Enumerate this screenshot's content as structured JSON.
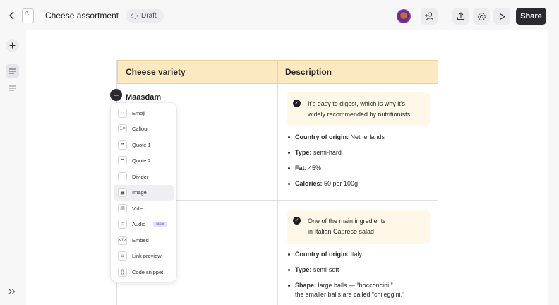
{
  "header": {
    "title": "Cheese assortment",
    "status": "Draft",
    "share_label": "Share"
  },
  "table": {
    "headers": [
      "Cheese variety",
      "Description"
    ],
    "rows": [
      {
        "name": "Maasdam",
        "callout_line1": "It's easy to digest, which is why it's",
        "callout_line2": "widely recommended by nutritionists.",
        "facts": [
          {
            "label": "Country of origin:",
            "value": "Netherlands"
          },
          {
            "label": "Type:",
            "value": "semi-hard"
          },
          {
            "label": "Fat:",
            "value": "45%"
          },
          {
            "label": "Calories:",
            "value": "50 per 100g"
          }
        ]
      },
      {
        "callout_line1": "One of the main ingredients",
        "callout_line2": "in Italian Caprese salad",
        "facts": [
          {
            "label": "Country of origin:",
            "value": "Italy"
          },
          {
            "label": "Type:",
            "value": "semi-soft"
          },
          {
            "label": "Shape:",
            "value": "large balls — “bocconcini,”",
            "value2": "the smaller balls are called “chileggini.”"
          }
        ]
      }
    ]
  },
  "insert_menu": {
    "items": [
      {
        "label": "Emoji",
        "icon": "emoji-icon",
        "glyph": "☺"
      },
      {
        "label": "Callout",
        "icon": "callout-icon",
        "glyph": "1≡"
      },
      {
        "label": "Quote 1",
        "icon": "quote-icon",
        "glyph": "❝"
      },
      {
        "label": "Quote 2",
        "icon": "quote-alt-icon",
        "glyph": "❞"
      },
      {
        "label": "Divider",
        "icon": "divider-icon",
        "glyph": "—"
      },
      {
        "label": "Image",
        "icon": "image-icon",
        "glyph": "▣"
      },
      {
        "label": "Video",
        "icon": "video-icon",
        "glyph": "▤"
      },
      {
        "label": "Audio",
        "icon": "audio-icon",
        "glyph": "♫",
        "badge": "New"
      },
      {
        "label": "Embed",
        "icon": "embed-icon",
        "glyph": "</>"
      },
      {
        "label": "Link preview",
        "icon": "bookmark-icon",
        "glyph": "⌑"
      },
      {
        "label": "Code snippet",
        "icon": "code-icon",
        "glyph": "{}"
      }
    ],
    "hovered": "Image"
  },
  "colors": {
    "header_bg": "#fde9c0",
    "callout_bg": "#fff7e8",
    "share_bg": "#2b2b2f",
    "accent": "#6b4fd8"
  }
}
